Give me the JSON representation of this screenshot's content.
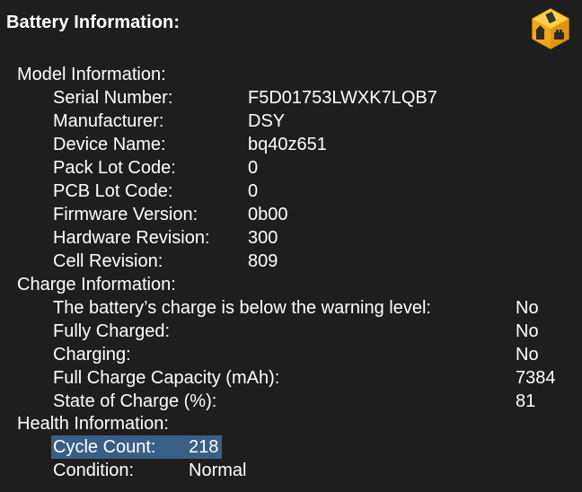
{
  "page": {
    "title": "Battery Information:",
    "app_icon": "system-information-icon"
  },
  "sections": {
    "model": {
      "heading": "Model Information:",
      "items": [
        {
          "label": "Serial Number:",
          "value": "F5D01753LWXK7LQB7"
        },
        {
          "label": "Manufacturer:",
          "value": "DSY"
        },
        {
          "label": "Device Name:",
          "value": "bq40z651"
        },
        {
          "label": "Pack Lot Code:",
          "value": "0"
        },
        {
          "label": "PCB Lot Code:",
          "value": "0"
        },
        {
          "label": "Firmware Version:",
          "value": "0b00"
        },
        {
          "label": "Hardware Revision:",
          "value": "300"
        },
        {
          "label": "Cell Revision:",
          "value": "809"
        }
      ]
    },
    "charge": {
      "heading": "Charge Information:",
      "items": [
        {
          "label": "The battery’s charge is below the warning level:",
          "value": "No"
        },
        {
          "label": "Fully Charged:",
          "value": "No"
        },
        {
          "label": "Charging:",
          "value": "No"
        },
        {
          "label": "Full Charge Capacity (mAh):",
          "value": "7384"
        },
        {
          "label": "State of Charge (%):",
          "value": "81"
        }
      ]
    },
    "health": {
      "heading": "Health Information:",
      "items": [
        {
          "label": "Cycle Count:",
          "value": "218"
        },
        {
          "label": "Condition:",
          "value": "Normal"
        }
      ]
    }
  }
}
